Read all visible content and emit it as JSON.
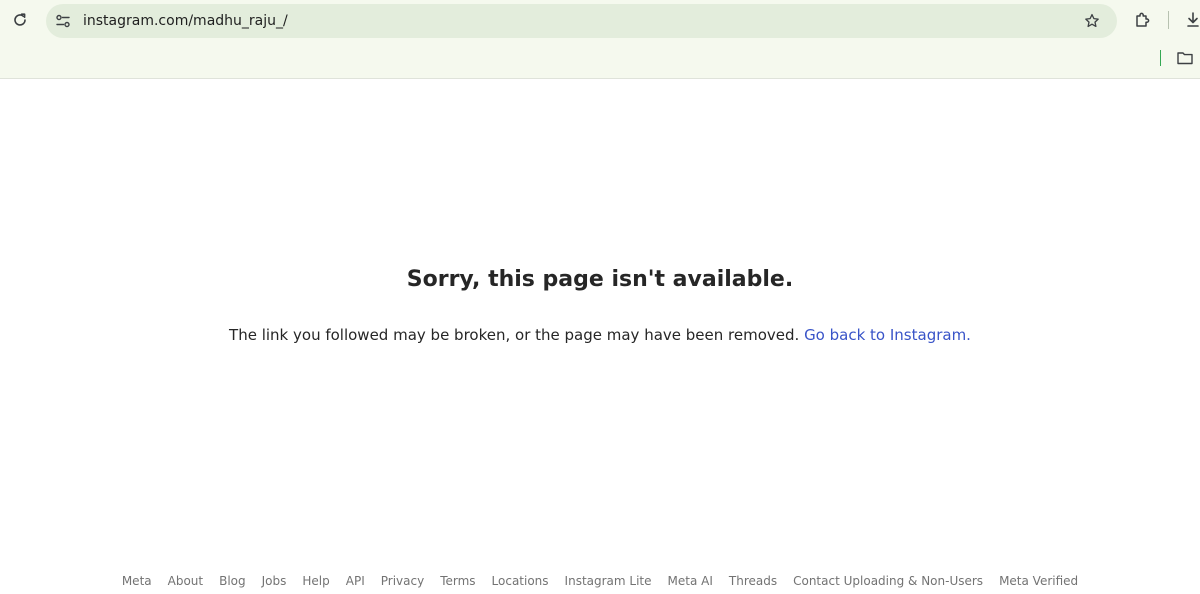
{
  "browser": {
    "url": "instagram.com/madhu_raju_/",
    "icons": {
      "reload": "reload-icon",
      "site_info": "site-info-icon",
      "bookmark": "star-icon",
      "extensions": "puzzle-icon",
      "download": "download-icon",
      "folder": "folder-icon"
    }
  },
  "page": {
    "title": "Sorry, this page isn't available.",
    "message": "The link you followed may be broken, or the page may have been removed.",
    "back_link": "Go back to Instagram."
  },
  "footer": {
    "links": [
      "Meta",
      "About",
      "Blog",
      "Jobs",
      "Help",
      "API",
      "Privacy",
      "Terms",
      "Locations",
      "Instagram Lite",
      "Meta AI",
      "Threads",
      "Contact Uploading & Non-Users",
      "Meta Verified"
    ]
  },
  "colors": {
    "link": "#3954c8",
    "text": "#262626",
    "muted": "#737373",
    "chrome_bg": "#f5f9ee",
    "omnibox_bg": "#e3eddc"
  }
}
